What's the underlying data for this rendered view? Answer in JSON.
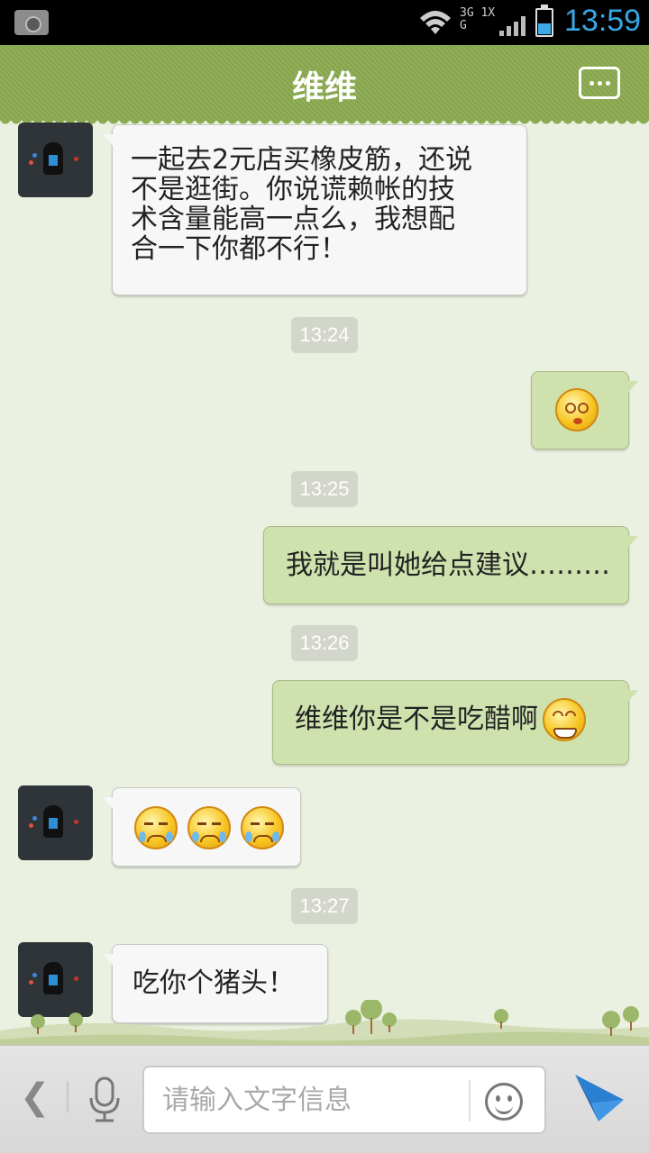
{
  "status": {
    "time": "13:59",
    "network": "3G 1X G"
  },
  "header": {
    "title": "维维"
  },
  "messages": [
    {
      "side": "in",
      "text": "一起去2元店买橡皮筋，还说\n不是逛街。你说谎赖帐的技\n术含量能高一点么，我想配\n合一下你都不行！"
    },
    {
      "timestamp": "13:24"
    },
    {
      "side": "out",
      "emoji": "dizzy-face-emoji"
    },
    {
      "timestamp": "13:25"
    },
    {
      "side": "out",
      "text": "我就是叫她给点建议………"
    },
    {
      "timestamp": "13:26"
    },
    {
      "side": "out",
      "text": "维维你是不是吃醋啊",
      "emoji": "grin-face-emoji"
    },
    {
      "side": "in",
      "emoji": "crying-face-emoji x3"
    },
    {
      "timestamp": "13:27"
    },
    {
      "side": "in",
      "text": "吃你个猪头！"
    }
  ],
  "texts": {
    "m1": "一起去2元店买橡皮筋，还说\n不是逛街。你说谎赖帐的技\n术含量能高一点么，我想配\n合一下你都不行！",
    "ts1": "13:24",
    "ts2": "13:25",
    "m3": "我就是叫她给点建议………",
    "ts3": "13:26",
    "m4": "维维你是不是吃醋啊",
    "ts4": "13:27",
    "m6": "吃你个猪头！"
  },
  "input": {
    "placeholder": "请输入文字信息",
    "value": ""
  },
  "colors": {
    "header": "#8bab50",
    "bubble_out": "#cfe2ae",
    "bubble_in": "#f7f7f7",
    "chat_bg": "#ebf1e0",
    "time": "#37a6e4"
  }
}
